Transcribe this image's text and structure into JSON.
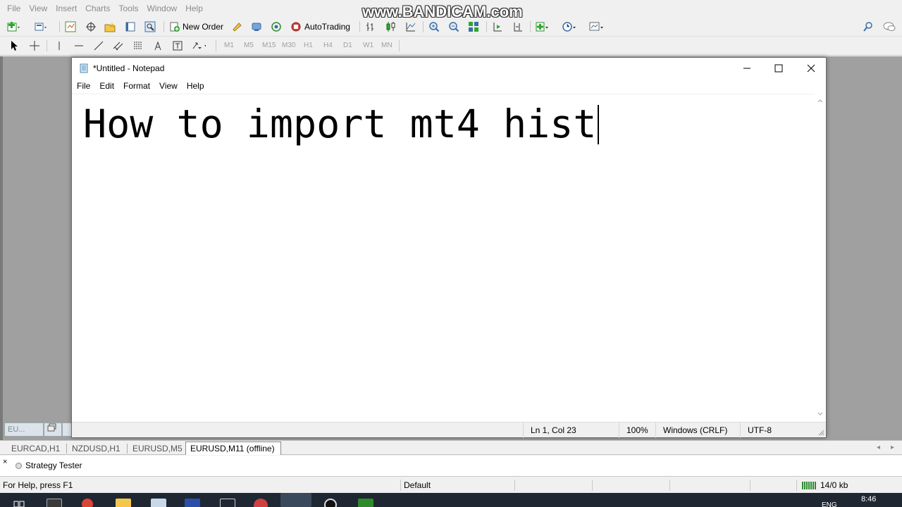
{
  "mt_menu": [
    "File",
    "View",
    "Insert",
    "Charts",
    "Tools",
    "Window",
    "Help"
  ],
  "watermark": "www.BANDICAM.com",
  "toolbar": {
    "new_order_label": "New Order",
    "autotrading_label": "AutoTrading"
  },
  "timeframes": [
    "M1",
    "M5",
    "M15",
    "M30",
    "H1",
    "H4",
    "D1",
    "W1",
    "MN"
  ],
  "mini_tab_label": "EU...",
  "notepad": {
    "title": "*Untitled - Notepad",
    "menu": [
      "File",
      "Edit",
      "Format",
      "View",
      "Help"
    ],
    "text": "How to import mt4 hist",
    "status": {
      "position": "Ln 1, Col 23",
      "zoom": "100%",
      "line_ending": "Windows (CRLF)",
      "encoding": "UTF-8"
    }
  },
  "chart_tabs": [
    {
      "label": "EURCAD,H1",
      "active": false
    },
    {
      "label": "NZDUSD,H1",
      "active": false
    },
    {
      "label": "EURUSD,M5",
      "active": false
    },
    {
      "label": "EURUSD,M11 (offline)",
      "active": true
    }
  ],
  "terminal": {
    "close_symbol": "×",
    "tab_label": "Strategy Tester"
  },
  "mt_status": {
    "help": "For Help, press F1",
    "profile": "Default",
    "traffic": "14/0 kb"
  },
  "taskbar": {
    "clock": "8:46",
    "lang": "ENG"
  },
  "colors": {
    "workspace": "#a0a0a0",
    "taskbar": "#1f2733",
    "notepad_bg": "#ffffff"
  }
}
